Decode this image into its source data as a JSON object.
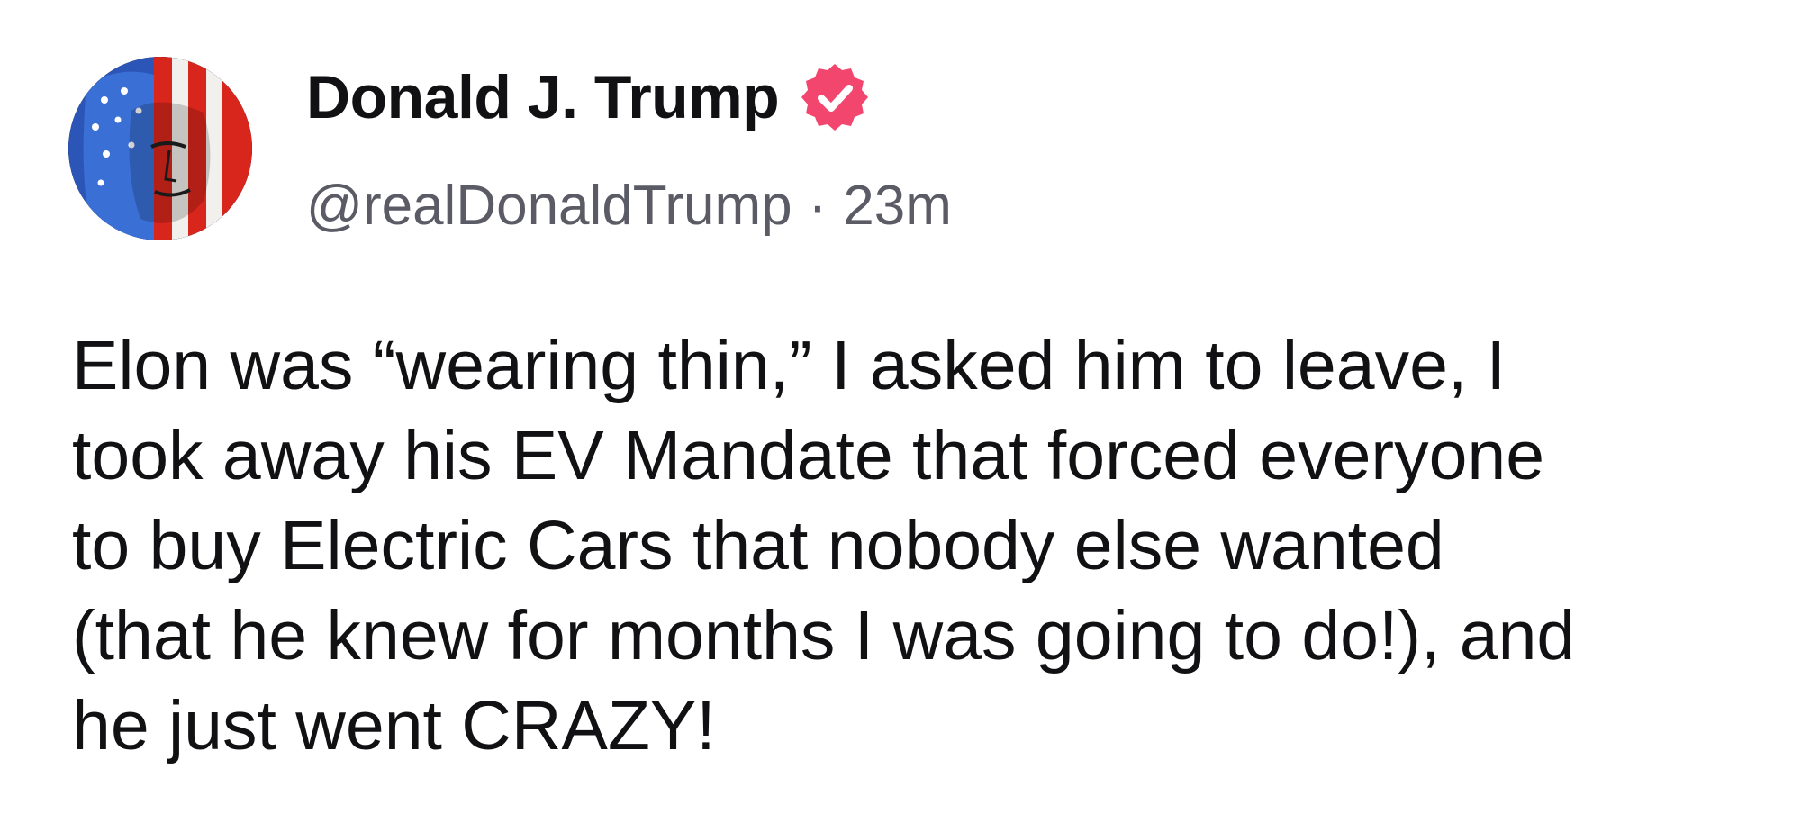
{
  "author": {
    "display_name": "Donald J. Trump",
    "handle": "@realDonaldTrump",
    "verified": true,
    "avatar_icon": "profile-avatar-american-flag-portrait"
  },
  "post": {
    "separator": "·",
    "timestamp": "23m",
    "lines": [
      "Elon was “wearing thin,” I asked him to leave, I",
      "took away his EV Mandate that forced everyone",
      "to buy Electric Cars that nobody else wanted",
      "(that he knew for months I was going to do!), and",
      "he just went CRAZY!"
    ]
  },
  "colors": {
    "verified_badge": "#f3466e",
    "name_text": "#111114",
    "meta_text": "#5b5b66",
    "background": "#ffffff"
  }
}
